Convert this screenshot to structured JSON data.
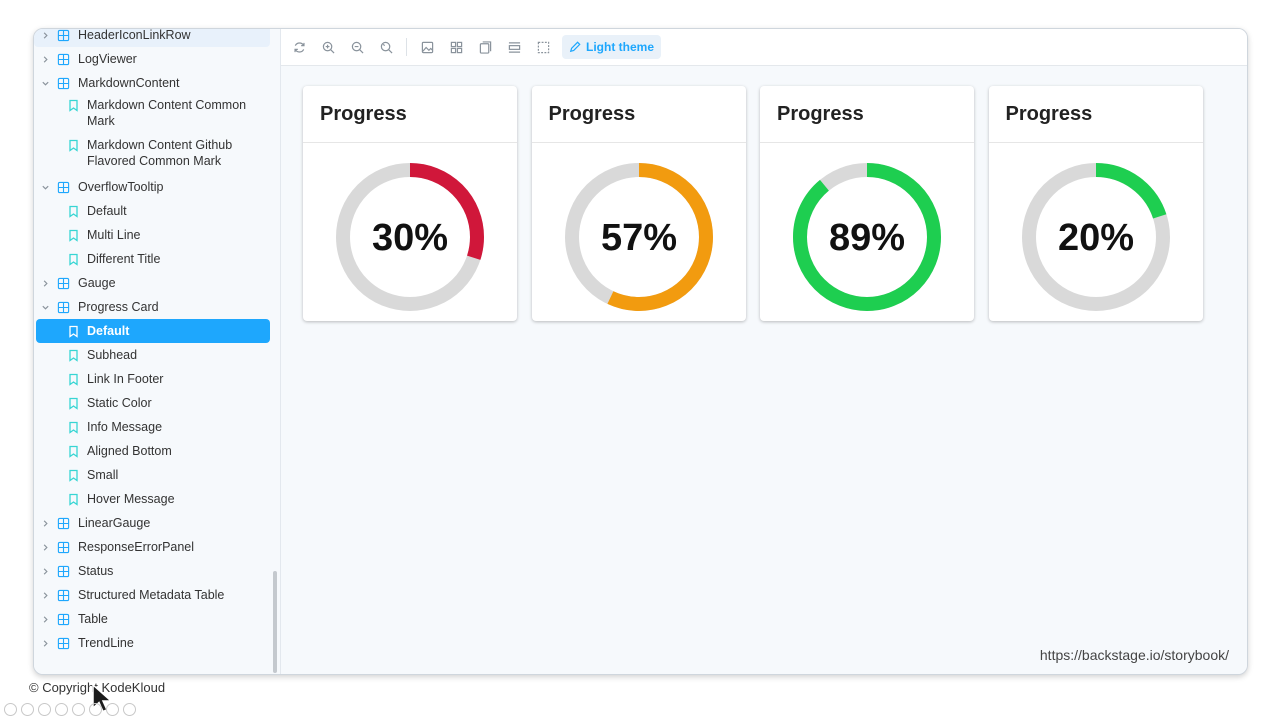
{
  "sidebar": {
    "items": [
      {
        "type": "group",
        "label": "HeaderIconLinkRow",
        "expanded": false,
        "hovered": true
      },
      {
        "type": "group",
        "label": "LogViewer",
        "expanded": false
      },
      {
        "type": "group",
        "label": "MarkdownContent",
        "expanded": true
      },
      {
        "type": "story",
        "label": "Markdown Content Common Mark",
        "tall": true
      },
      {
        "type": "story",
        "label": "Markdown Content Github Flavored Common Mark",
        "tall": true
      },
      {
        "type": "group",
        "label": "OverflowTooltip",
        "expanded": true
      },
      {
        "type": "story",
        "label": "Default"
      },
      {
        "type": "story",
        "label": "Multi Line"
      },
      {
        "type": "story",
        "label": "Different Title"
      },
      {
        "type": "group",
        "label": "Gauge",
        "expanded": false
      },
      {
        "type": "group",
        "label": "Progress Card",
        "expanded": true
      },
      {
        "type": "story",
        "label": "Default",
        "selected": true
      },
      {
        "type": "story",
        "label": "Subhead"
      },
      {
        "type": "story",
        "label": "Link In Footer"
      },
      {
        "type": "story",
        "label": "Static Color"
      },
      {
        "type": "story",
        "label": "Info Message"
      },
      {
        "type": "story",
        "label": "Aligned Bottom"
      },
      {
        "type": "story",
        "label": "Small"
      },
      {
        "type": "story",
        "label": "Hover Message"
      },
      {
        "type": "group",
        "label": "LinearGauge",
        "expanded": false
      },
      {
        "type": "group",
        "label": "ResponseErrorPanel",
        "expanded": false
      },
      {
        "type": "group",
        "label": "Status",
        "expanded": false
      },
      {
        "type": "group",
        "label": "Structured Metadata Table",
        "expanded": false
      },
      {
        "type": "group",
        "label": "Table",
        "expanded": false
      },
      {
        "type": "group",
        "label": "TrendLine",
        "expanded": false
      }
    ]
  },
  "toolbar": {
    "theme_label": "Light theme",
    "icons": [
      "reload-icon",
      "zoom-in-icon",
      "zoom-out-icon",
      "reset-zoom-icon",
      "background-icon",
      "grid-icon",
      "viewport-icon",
      "measure-icon",
      "outline-icon"
    ]
  },
  "cards": [
    {
      "title": "Progress",
      "value": 30,
      "label": "30%",
      "color": "#d0173a"
    },
    {
      "title": "Progress",
      "value": 57,
      "label": "57%",
      "color": "#f29b0f"
    },
    {
      "title": "Progress",
      "value": 89,
      "label": "89%",
      "color": "#1ece50"
    },
    {
      "title": "Progress",
      "value": 20,
      "label": "20%",
      "color": "#1ece50"
    }
  ],
  "colors": {
    "accent": "#1ea7fd",
    "track": "#d9d9d9"
  },
  "url": "https://backstage.io/storybook/",
  "footer": "© Copyright KodeKloud"
}
